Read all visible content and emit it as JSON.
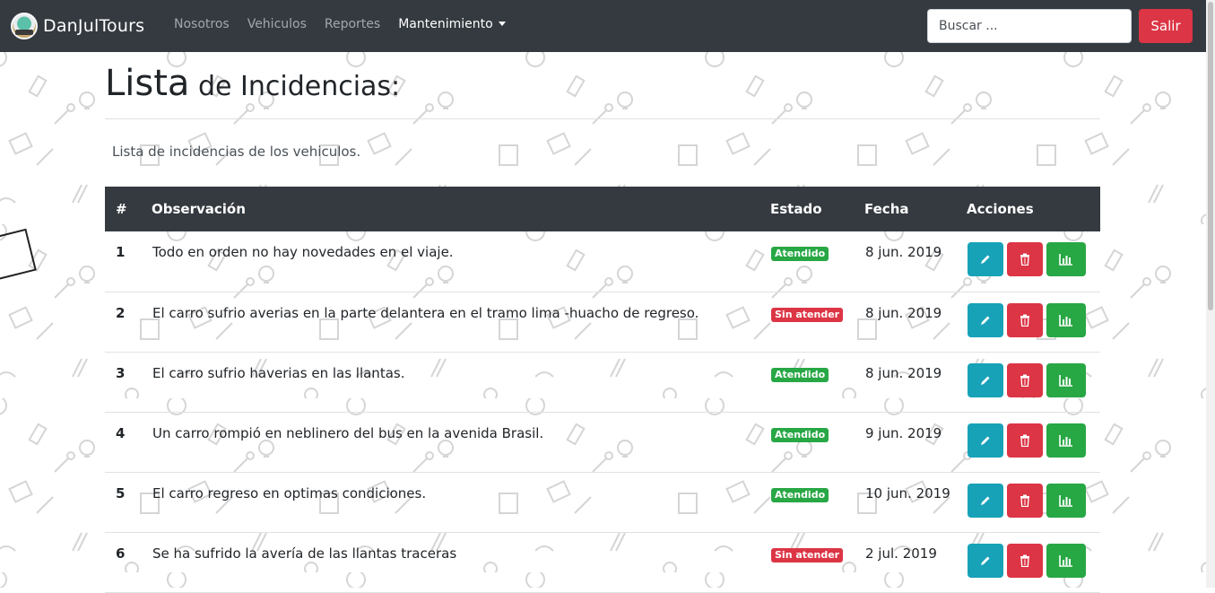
{
  "brand": {
    "name": "DanJulTours"
  },
  "nav": {
    "links": [
      {
        "label": "Nosotros"
      },
      {
        "label": "Vehiculos"
      },
      {
        "label": "Reportes"
      },
      {
        "label": "Mantenimiento"
      }
    ]
  },
  "search": {
    "placeholder": "Buscar ..."
  },
  "logout": {
    "label": "Salir"
  },
  "page": {
    "title_big": "Lista",
    "title_small": " de Incidencias:",
    "subtitle": "Lista de incidencias de los vehiculos."
  },
  "table": {
    "headers": [
      "#",
      "Observación",
      "Estado",
      "Fecha",
      "Acciones"
    ],
    "rows": [
      {
        "num": "1",
        "obs": "Todo en orden no hay novedades en el viaje.",
        "estado": "Atendido",
        "status": "success",
        "fecha": "8 jun. 2019"
      },
      {
        "num": "2",
        "obs": "El carro sufrio averias en la parte delantera en el tramo lima -huacho de regreso.",
        "estado": "Sin atender",
        "status": "danger",
        "fecha": "8 jun. 2019"
      },
      {
        "num": "3",
        "obs": "El carro sufrio haverias en las llantas.",
        "estado": "Atendido",
        "status": "success",
        "fecha": "8 jun. 2019"
      },
      {
        "num": "4",
        "obs": "Un carro rompió en neblinero del bus en la avenida Brasil.",
        "estado": "Atendido",
        "status": "success",
        "fecha": "9 jun. 2019"
      },
      {
        "num": "5",
        "obs": "El carro regreso en optimas condiciones.",
        "estado": "Atendido",
        "status": "success",
        "fecha": "10 jun. 2019"
      },
      {
        "num": "6",
        "obs": "Se ha sufrido la avería de las llantas traceras",
        "estado": "Sin atender",
        "status": "danger",
        "fecha": "2 jul. 2019"
      }
    ]
  },
  "colors": {
    "navbar": "#343a40",
    "success": "#28a745",
    "danger": "#dc3545",
    "info": "#17a2b8"
  },
  "icons": {
    "edit": "pencil-icon",
    "delete": "trash-icon",
    "chart": "bar-chart-icon",
    "logo": "logo-icon",
    "dropdown": "caret-down-icon"
  }
}
